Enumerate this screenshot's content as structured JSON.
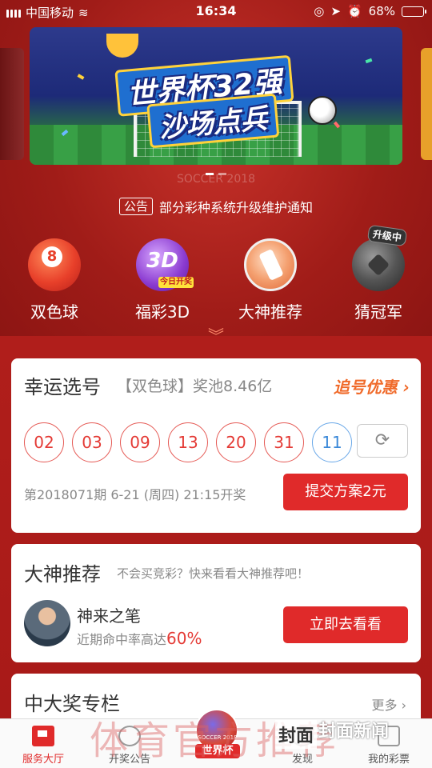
{
  "status_bar": {
    "carrier": "中国移动",
    "time": "16:34",
    "battery": "68%",
    "battery_level": 0.68
  },
  "banner": {
    "line1": "世界杯32强",
    "line2": "沙场点兵",
    "watermark": "SOCCER 2018"
  },
  "notice": {
    "tag": "公告",
    "text": "部分彩种系统升级维护通知"
  },
  "categories": [
    {
      "label": "双色球",
      "icon": "red-ball-icon",
      "num": "8"
    },
    {
      "label": "福彩3D",
      "icon": "3d-icon",
      "badge": "今日开奖"
    },
    {
      "label": "大神推荐",
      "icon": "hand-flag-icon"
    },
    {
      "label": "猜冠军",
      "icon": "soccer-ball-icon",
      "badge": "升级中"
    }
  ],
  "lucky": {
    "title": "幸运选号",
    "subtitle": "【双色球】奖池8.46亿",
    "promo": "追号优惠 ›",
    "red_balls": [
      "02",
      "03",
      "09",
      "13",
      "20",
      "31"
    ],
    "blue_ball": "11",
    "issue": "第2018071期   6-21 (周四) 21:15开奖",
    "submit": "提交方案2元"
  },
  "master": {
    "title": "大神推荐",
    "subtitle": "不会买竞彩？快来看看大神推荐吧！",
    "name": "神来之笔",
    "rate_prefix": "近期命中率高达",
    "rate": "60%",
    "button": "立即去看看"
  },
  "prize": {
    "title": "中大奖专栏",
    "more": "更多 ›"
  },
  "tabbar": {
    "tabs": [
      {
        "label": "服务大厅",
        "active": true
      },
      {
        "label": "开奖公告",
        "active": false
      },
      {
        "label": "发现",
        "active": false
      },
      {
        "label": "我的彩票",
        "active": false
      }
    ],
    "center_badge": "世界杯",
    "center_text": "SOCCER 2018"
  },
  "overlays": {
    "watermark": "体育官方推荐",
    "brand": "封面",
    "brand2": "封面新闻"
  }
}
